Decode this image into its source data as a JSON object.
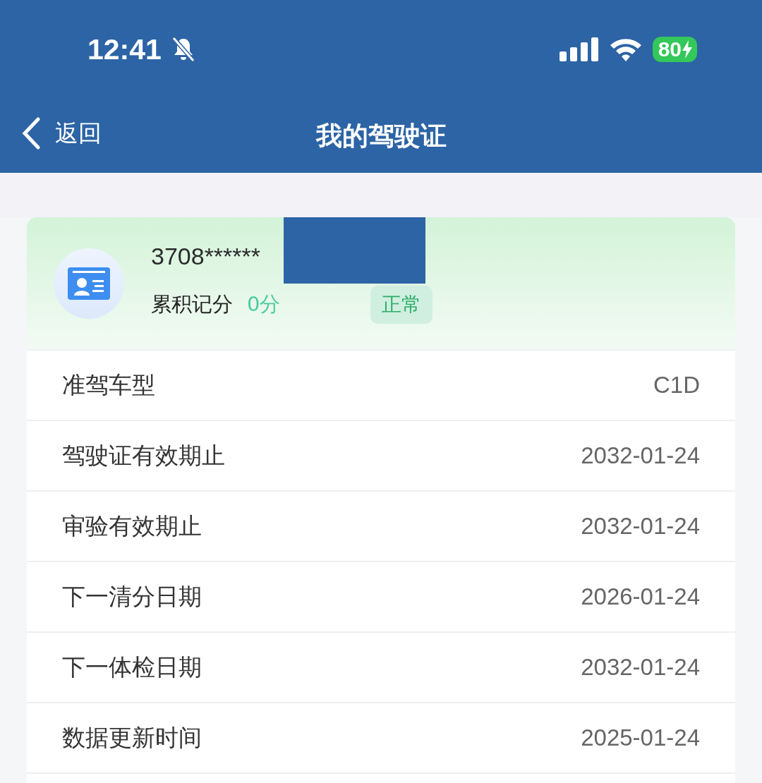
{
  "status_bar": {
    "time": "12:41",
    "battery": "80"
  },
  "nav": {
    "back": "返回",
    "title": "我的驾驶证"
  },
  "license": {
    "number": "3708******",
    "points_label": "累积记分",
    "points": "0分",
    "status": "正常"
  },
  "rows": [
    {
      "label": "准驾车型",
      "value": "C1D"
    },
    {
      "label": "驾驶证有效期止",
      "value": "2032-01-24"
    },
    {
      "label": "审验有效期止",
      "value": "2032-01-24"
    },
    {
      "label": "下一清分日期",
      "value": "2026-01-24"
    },
    {
      "label": "下一体检日期",
      "value": "2032-01-24"
    },
    {
      "label": "数据更新时间",
      "value": "2025-01-24"
    }
  ]
}
